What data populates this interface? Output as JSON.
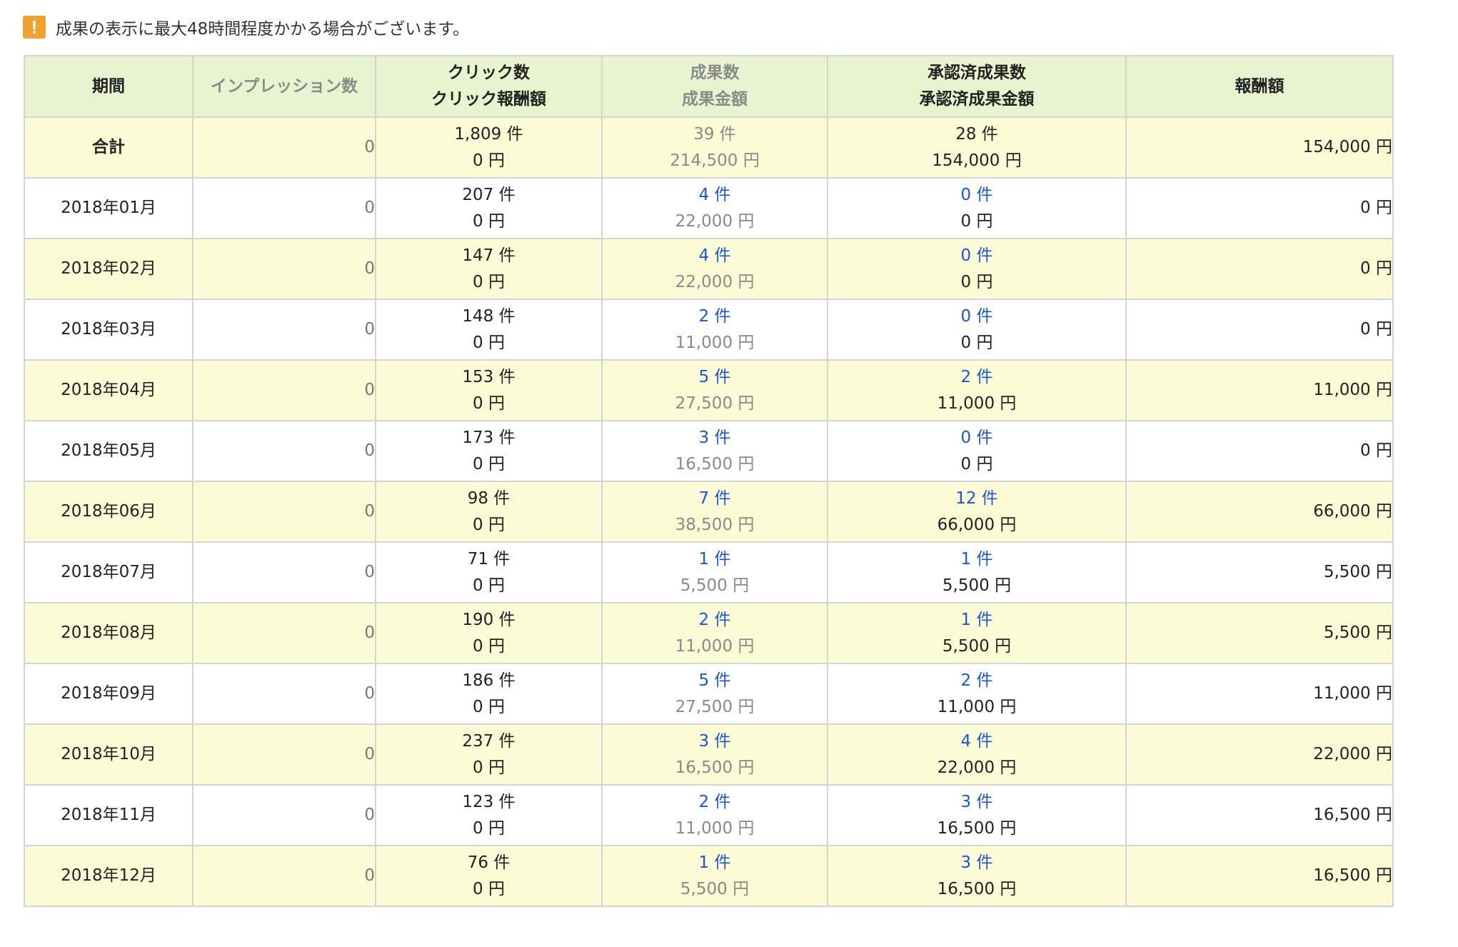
{
  "notice": {
    "icon": "exclamation-icon",
    "icon_glyph": "!",
    "text": "成果の表示に最大48時間程度かかる場合がございます。"
  },
  "table": {
    "headers": {
      "period": "期間",
      "impressions": "インプレッション数",
      "clicks_line1": "クリック数",
      "clicks_line2": "クリック報酬額",
      "results_line1": "成果数",
      "results_line2": "成果金額",
      "approved_line1": "承認済成果数",
      "approved_line2": "承認済成果金額",
      "reward": "報酬額"
    },
    "rows": [
      {
        "period": "合計",
        "impressions": "0",
        "clicks": "1,809 件",
        "click_reward": "0 円",
        "results": "39 件",
        "result_amount": "214,500 円",
        "approved": "28 件",
        "approved_amount": "154,000 円",
        "reward": "154,000 円"
      },
      {
        "period": "2018年01月",
        "impressions": "0",
        "clicks": "207 件",
        "click_reward": "0 円",
        "results": "4 件",
        "result_amount": "22,000 円",
        "approved": "0 件",
        "approved_amount": "0 円",
        "reward": "0 円"
      },
      {
        "period": "2018年02月",
        "impressions": "0",
        "clicks": "147 件",
        "click_reward": "0 円",
        "results": "4 件",
        "result_amount": "22,000 円",
        "approved": "0 件",
        "approved_amount": "0 円",
        "reward": "0 円"
      },
      {
        "period": "2018年03月",
        "impressions": "0",
        "clicks": "148 件",
        "click_reward": "0 円",
        "results": "2 件",
        "result_amount": "11,000 円",
        "approved": "0 件",
        "approved_amount": "0 円",
        "reward": "0 円"
      },
      {
        "period": "2018年04月",
        "impressions": "0",
        "clicks": "153 件",
        "click_reward": "0 円",
        "results": "5 件",
        "result_amount": "27,500 円",
        "approved": "2 件",
        "approved_amount": "11,000 円",
        "reward": "11,000 円"
      },
      {
        "period": "2018年05月",
        "impressions": "0",
        "clicks": "173 件",
        "click_reward": "0 円",
        "results": "3 件",
        "result_amount": "16,500 円",
        "approved": "0 件",
        "approved_amount": "0 円",
        "reward": "0 円"
      },
      {
        "period": "2018年06月",
        "impressions": "0",
        "clicks": "98 件",
        "click_reward": "0 円",
        "results": "7 件",
        "result_amount": "38,500 円",
        "approved": "12 件",
        "approved_amount": "66,000 円",
        "reward": "66,000 円"
      },
      {
        "period": "2018年07月",
        "impressions": "0",
        "clicks": "71 件",
        "click_reward": "0 円",
        "results": "1 件",
        "result_amount": "5,500 円",
        "approved": "1 件",
        "approved_amount": "5,500 円",
        "reward": "5,500 円"
      },
      {
        "period": "2018年08月",
        "impressions": "0",
        "clicks": "190 件",
        "click_reward": "0 円",
        "results": "2 件",
        "result_amount": "11,000 円",
        "approved": "1 件",
        "approved_amount": "5,500 円",
        "reward": "5,500 円"
      },
      {
        "period": "2018年09月",
        "impressions": "0",
        "clicks": "186 件",
        "click_reward": "0 円",
        "results": "5 件",
        "result_amount": "27,500 円",
        "approved": "2 件",
        "approved_amount": "11,000 円",
        "reward": "11,000 円"
      },
      {
        "period": "2018年10月",
        "impressions": "0",
        "clicks": "237 件",
        "click_reward": "0 円",
        "results": "3 件",
        "result_amount": "16,500 円",
        "approved": "4 件",
        "approved_amount": "22,000 円",
        "reward": "22,000 円"
      },
      {
        "period": "2018年11月",
        "impressions": "0",
        "clicks": "123 件",
        "click_reward": "0 円",
        "results": "2 件",
        "result_amount": "11,000 円",
        "approved": "3 件",
        "approved_amount": "16,500 円",
        "reward": "16,500 円"
      },
      {
        "period": "2018年12月",
        "impressions": "0",
        "clicks": "76 件",
        "click_reward": "0 円",
        "results": "1 件",
        "result_amount": "5,500 円",
        "approved": "3 件",
        "approved_amount": "16,500 円",
        "reward": "16,500 円"
      }
    ]
  },
  "colors": {
    "header_bg": "#e8f3d0",
    "odd_row_bg": "#fbfbd6",
    "link_blue": "#1a56d6",
    "muted_gray": "#8a8a8a",
    "notice_icon": "#f0a22e"
  }
}
